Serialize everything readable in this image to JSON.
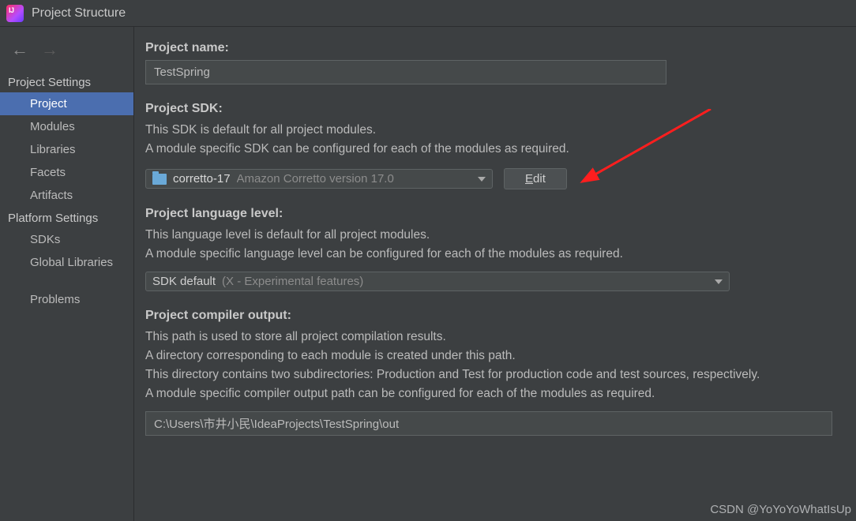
{
  "window": {
    "title": "Project Structure"
  },
  "sidebar": {
    "sections": [
      {
        "header": "Project Settings",
        "items": [
          {
            "label": "Project",
            "selected": true
          },
          {
            "label": "Modules",
            "selected": false
          },
          {
            "label": "Libraries",
            "selected": false
          },
          {
            "label": "Facets",
            "selected": false
          },
          {
            "label": "Artifacts",
            "selected": false
          }
        ]
      },
      {
        "header": "Platform Settings",
        "items": [
          {
            "label": "SDKs",
            "selected": false
          },
          {
            "label": "Global Libraries",
            "selected": false
          }
        ]
      },
      {
        "header": null,
        "items": [
          {
            "label": "Problems",
            "selected": false
          }
        ]
      }
    ]
  },
  "project": {
    "name_label": "Project name:",
    "name_value": "TestSpring",
    "sdk_label": "Project SDK:",
    "sdk_desc1": "This SDK is default for all project modules.",
    "sdk_desc2": "A module specific SDK can be configured for each of the modules as required.",
    "sdk_name": "corretto-17",
    "sdk_version": "Amazon Corretto version 17.0",
    "edit_label": "Edit",
    "edit_hotkey": "E",
    "edit_suffix": "dit",
    "lang_label": "Project language level:",
    "lang_desc1": "This language level is default for all project modules.",
    "lang_desc2": "A module specific language level can be configured for each of the modules as required.",
    "lang_value_prefix": "SDK default",
    "lang_value_suffix": " (X - Experimental features)",
    "compiler_label": "Project compiler output:",
    "compiler_desc1": "This path is used to store all project compilation results.",
    "compiler_desc2": "A directory corresponding to each module is created under this path.",
    "compiler_desc3": "This directory contains two subdirectories: Production and Test for production code and test sources, respectively.",
    "compiler_desc4": "A module specific compiler output path can be configured for each of the modules as required.",
    "compiler_path": "C:\\Users\\市井小民\\IdeaProjects\\TestSpring\\out"
  },
  "watermark": "CSDN @YoYoYoWhatIsUp"
}
